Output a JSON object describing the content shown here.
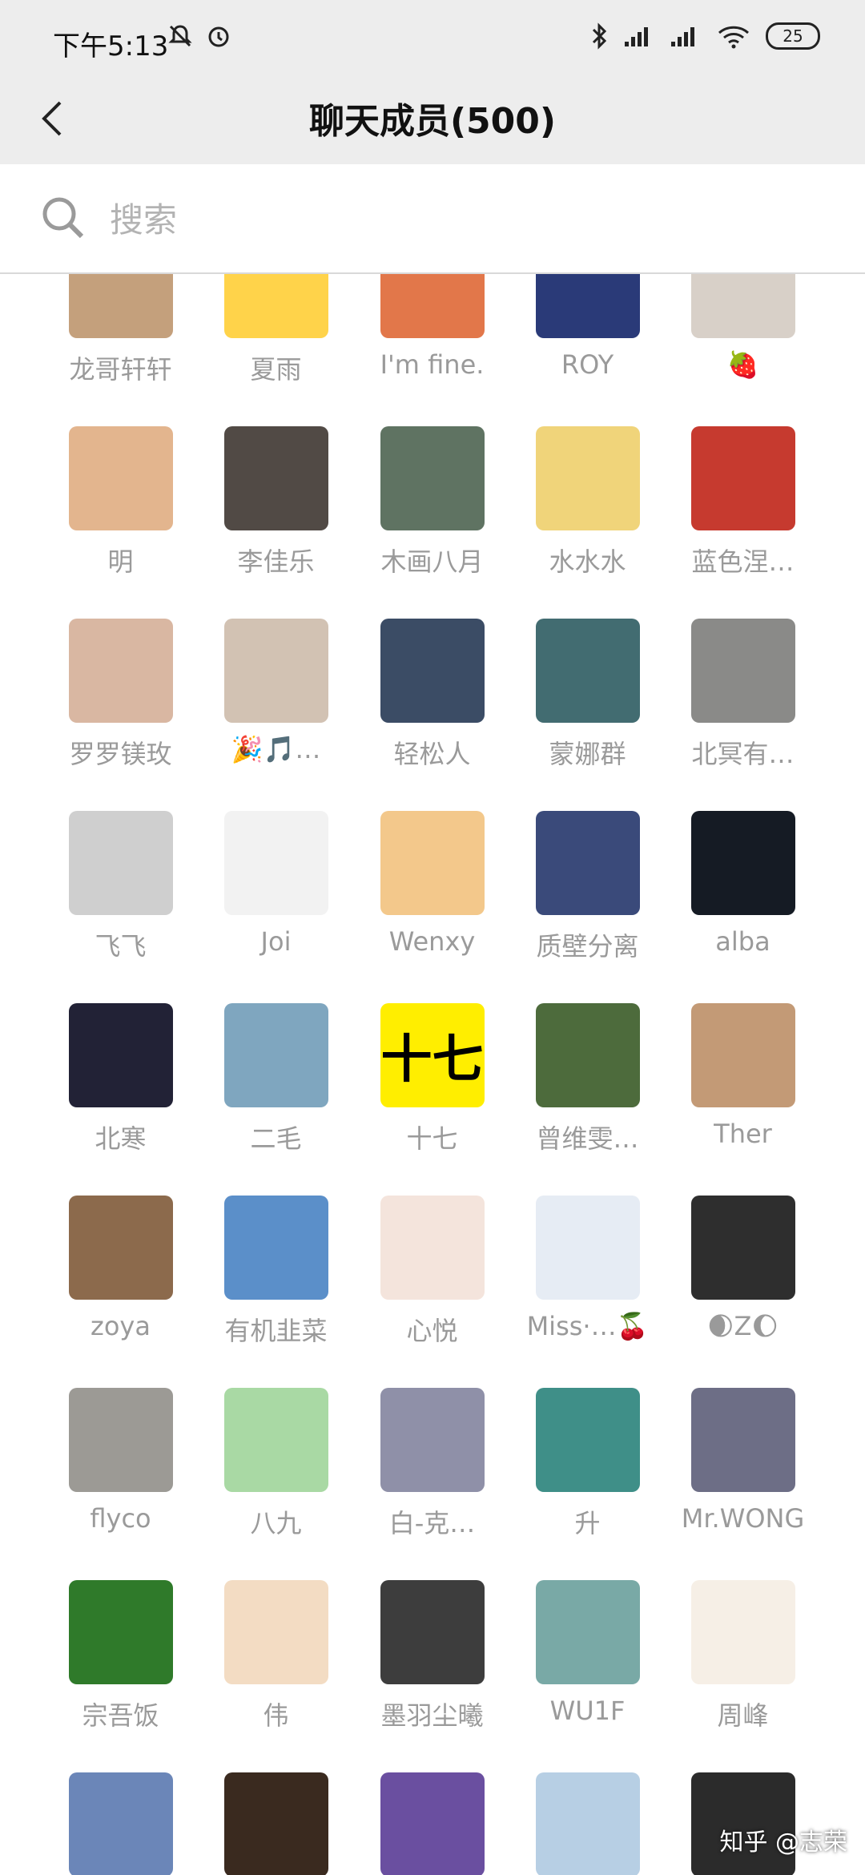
{
  "status": {
    "time": "下午5:13",
    "battery": "25",
    "icons": [
      "mute-bell-icon",
      "alarm-icon",
      "bluetooth-icon",
      "signal-icon",
      "signal-icon",
      "wifi-icon"
    ]
  },
  "nav": {
    "title": "聊天成员(500)",
    "back": "back-icon"
  },
  "search": {
    "placeholder": "搜索"
  },
  "members": [
    {
      "name": "龙哥轩轩",
      "color": "#c4a07c"
    },
    {
      "name": "夏雨",
      "color": "#ffd34a"
    },
    {
      "name": "I'm fine.",
      "color": "#e2774a"
    },
    {
      "name": "ROY",
      "color": "#2a3a78"
    },
    {
      "name": "🍓",
      "color": "#d8d0c8"
    },
    {
      "name": "明",
      "color": "#e3b58e"
    },
    {
      "name": "李佳乐",
      "color": "#514a45"
    },
    {
      "name": "木画八月",
      "color": "#5f7362"
    },
    {
      "name": "水水水",
      "color": "#f0d47a"
    },
    {
      "name": "蓝色涅…",
      "color": "#c63a2f"
    },
    {
      "name": "罗罗镁玫",
      "color": "#d9b7a2"
    },
    {
      "name": "🎉🎵…",
      "color": "#d2c2b3"
    },
    {
      "name": "轻松人",
      "color": "#3b4c65"
    },
    {
      "name": "蒙娜群",
      "color": "#426c71"
    },
    {
      "name": "北冥有…",
      "color": "#8a8a88"
    },
    {
      "name": "飞飞",
      "color": "#cfcfcf"
    },
    {
      "name": "Joi",
      "color": "#f2f2f2"
    },
    {
      "name": "Wenxy",
      "color": "#f3c88b"
    },
    {
      "name": "质壁分离",
      "color": "#3a4a7a"
    },
    {
      "name": "alba",
      "color": "#151b24"
    },
    {
      "name": "北寒",
      "color": "#222236"
    },
    {
      "name": "二毛",
      "color": "#7fa6bf"
    },
    {
      "name": "十七",
      "color": "#ffee00",
      "text": "十七"
    },
    {
      "name": "曾维雯…",
      "color": "#4d6b3c"
    },
    {
      "name": "Ther",
      "color": "#c39a76"
    },
    {
      "name": "zoya",
      "color": "#8c6a4c"
    },
    {
      "name": "有机韭菜",
      "color": "#5b8fc9"
    },
    {
      "name": "心悦",
      "color": "#f4e4dc"
    },
    {
      "name": "Miss·…🍒",
      "color": "#e6ecf4"
    },
    {
      "name": "🌒Z🌔",
      "color": "#2e2e2e"
    },
    {
      "name": "flyco",
      "color": "#9c9a95"
    },
    {
      "name": "八九",
      "color": "#a9d9a4"
    },
    {
      "name": "白-克…",
      "color": "#8f90a8"
    },
    {
      "name": "升",
      "color": "#3f8f88"
    },
    {
      "name": "Mr.WONG",
      "color": "#6d6e86"
    },
    {
      "name": "宗吾饭",
      "color": "#2f7a2a"
    },
    {
      "name": "伟",
      "color": "#f3dcc3"
    },
    {
      "name": "墨羽尘曦",
      "color": "#3d3d3d"
    },
    {
      "name": "WU1F",
      "color": "#79a9a6"
    },
    {
      "name": "周峰",
      "color": "#f6efe6"
    },
    {
      "name": "",
      "color": "#6b86b8"
    },
    {
      "name": "",
      "color": "#3a2a1f"
    },
    {
      "name": "",
      "color": "#6a4fa0"
    },
    {
      "name": "",
      "color": "#b7cfe4"
    },
    {
      "name": "",
      "color": "#2b2b2b"
    }
  ],
  "watermark": "知乎 @志荣"
}
